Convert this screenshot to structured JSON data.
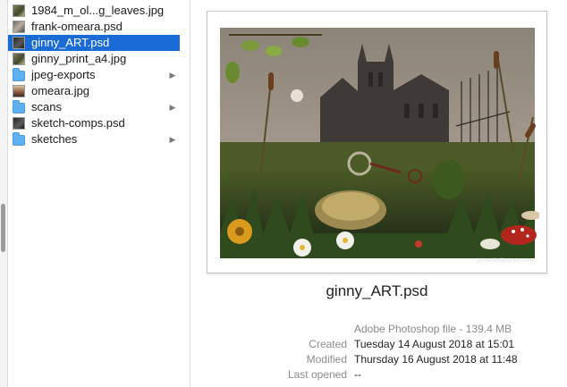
{
  "files": [
    {
      "label": "1984_m_ol...g_leaves.jpg",
      "icon": "image-file-icon",
      "selected": false,
      "has_children": false
    },
    {
      "label": "frank-omeara.psd",
      "icon": "psd-file-icon",
      "selected": false,
      "has_children": false
    },
    {
      "label": "ginny_ART.psd",
      "icon": "psd-file-icon",
      "selected": true,
      "has_children": false
    },
    {
      "label": "ginny_print_a4.jpg",
      "icon": "image-file-icon",
      "selected": false,
      "has_children": false
    },
    {
      "label": "jpeg-exports",
      "icon": "folder-icon",
      "selected": false,
      "has_children": true
    },
    {
      "label": "omeara.jpg",
      "icon": "image-file-icon",
      "selected": false,
      "has_children": false
    },
    {
      "label": "scans",
      "icon": "folder-icon",
      "selected": false,
      "has_children": true
    },
    {
      "label": "sketch-comps.psd",
      "icon": "psd-file-icon",
      "selected": false,
      "has_children": false
    },
    {
      "label": "sketches",
      "icon": "folder-icon",
      "selected": false,
      "has_children": true
    }
  ],
  "preview": {
    "filename": "ginny_ART.psd",
    "kind": "Adobe Photoshop file - 139.4 MB",
    "meta": [
      {
        "key": "Created",
        "value": "Tuesday 14 August 2018 at 15:01"
      },
      {
        "key": "Modified",
        "value": "Thursday 16 August 2018 at 11:48"
      },
      {
        "key": "Last opened",
        "value": "--"
      }
    ],
    "watermark": "johnwhiteillustrator.com"
  },
  "colors": {
    "selection": "#1a6bd6",
    "folder": "#5fb0f0"
  }
}
